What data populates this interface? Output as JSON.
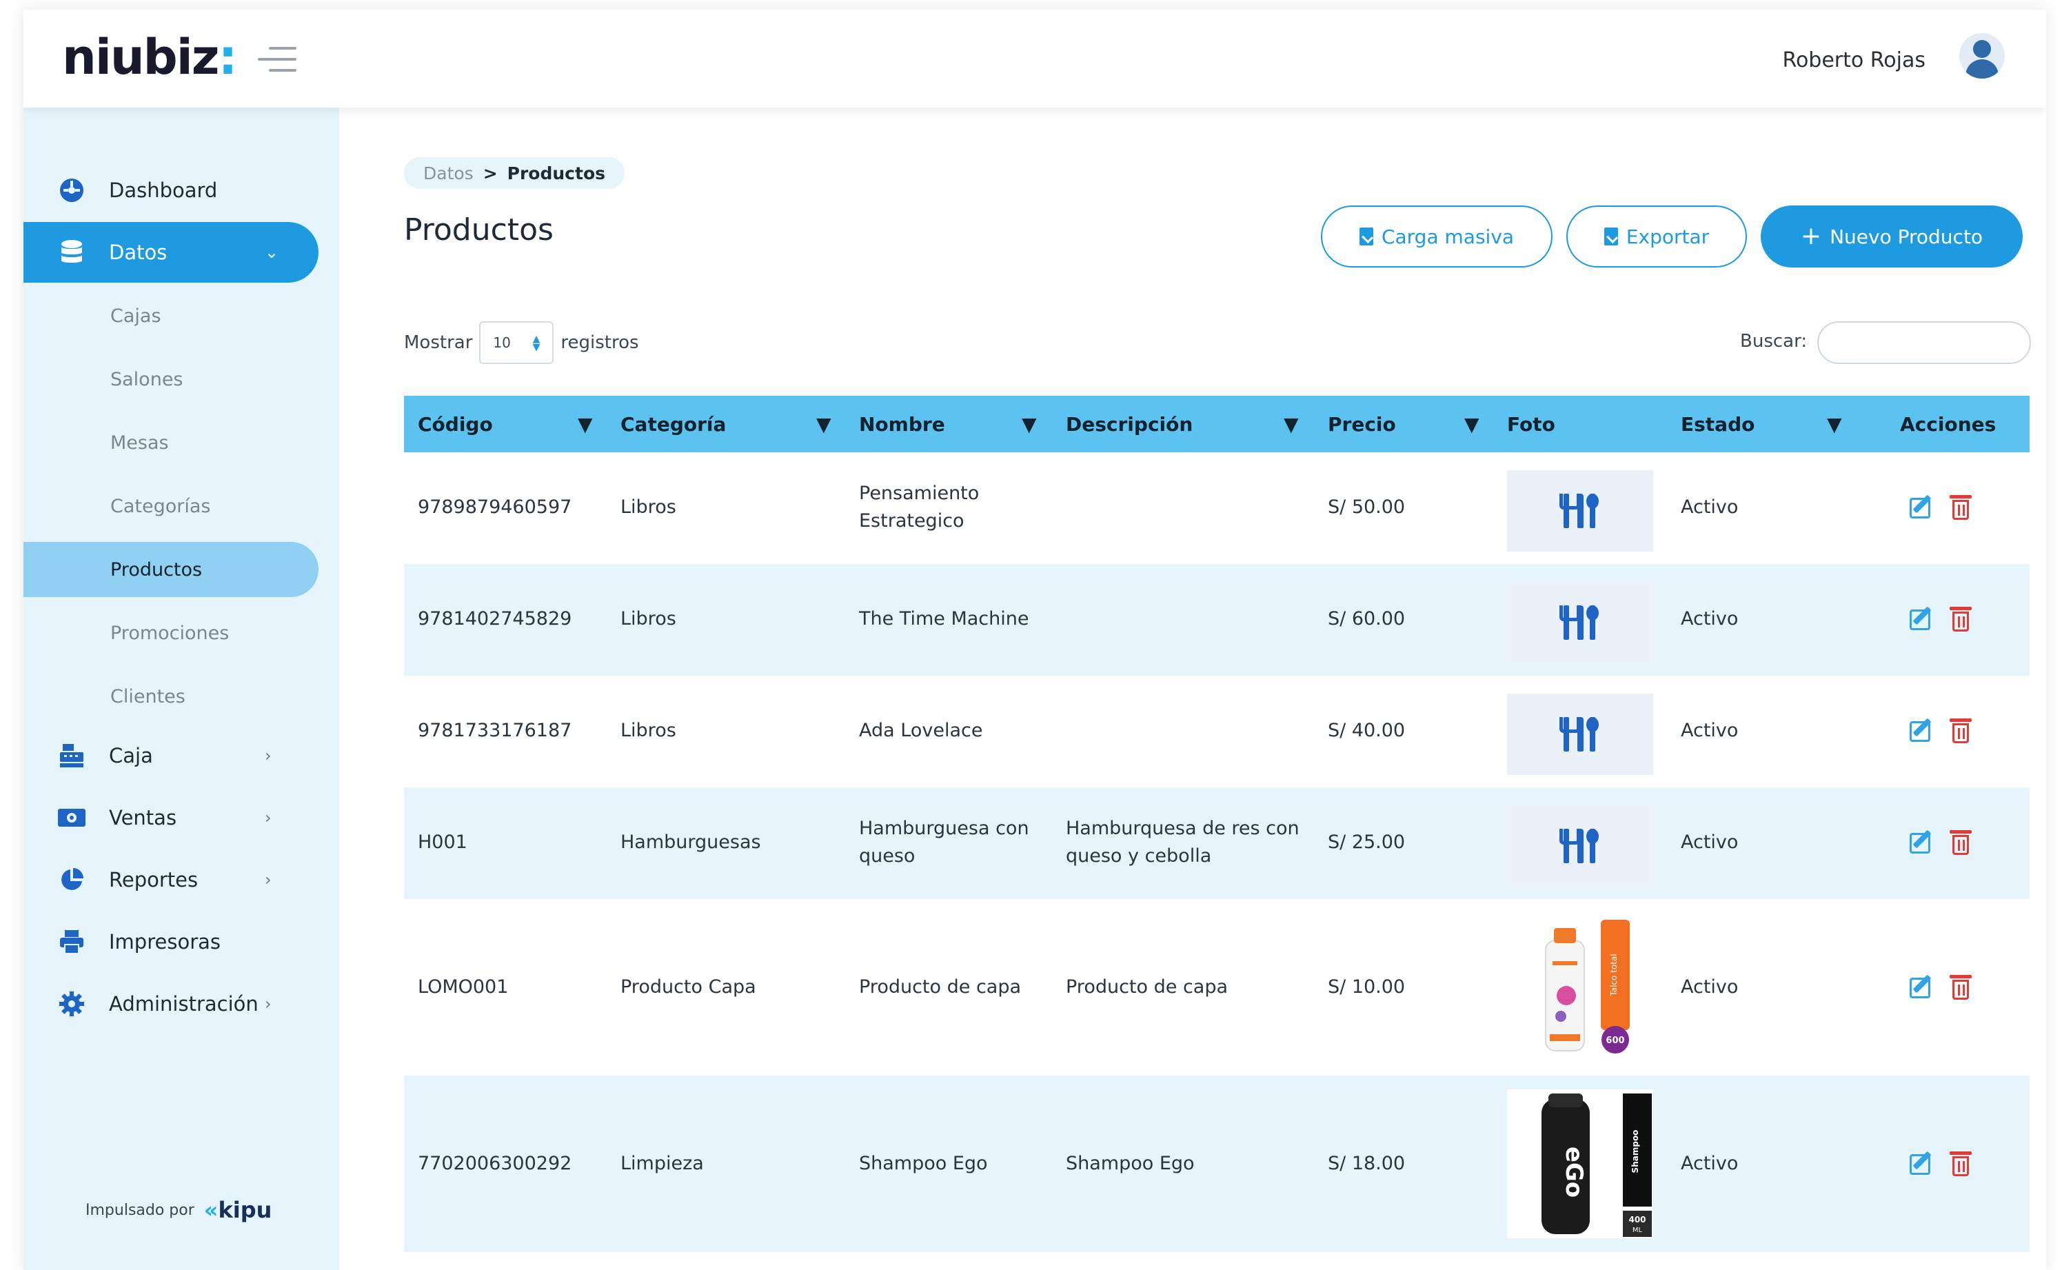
{
  "header": {
    "logo_text": "niubiz",
    "logo_colon": ":",
    "user_name": "Roberto Rojas"
  },
  "sidebar": {
    "items": [
      {
        "label": "Dashboard",
        "icon": "dashboard-icon"
      },
      {
        "label": "Datos",
        "icon": "database-icon",
        "chevron": "⌄"
      },
      {
        "label": "Caja",
        "icon": "cash-register-icon",
        "chevron": "›"
      },
      {
        "label": "Ventas",
        "icon": "money-icon",
        "chevron": "›"
      },
      {
        "label": "Reportes",
        "icon": "pie-chart-icon",
        "chevron": "›"
      },
      {
        "label": "Impresoras",
        "icon": "printer-icon"
      },
      {
        "label": "Administración",
        "icon": "gear-icon",
        "chevron": "›"
      }
    ],
    "sub_items": [
      {
        "label": "Cajas"
      },
      {
        "label": "Salones"
      },
      {
        "label": "Mesas"
      },
      {
        "label": "Categorías"
      },
      {
        "label": "Productos"
      },
      {
        "label": "Promociones"
      },
      {
        "label": "Clientes"
      }
    ],
    "powered_by": "Impulsado por",
    "powered_brand": "kipu"
  },
  "main": {
    "breadcrumb_parent": "Datos",
    "breadcrumb_sep": ">",
    "breadcrumb_current": "Productos",
    "title": "Productos",
    "buttons": {
      "bulk_upload": "Carga masiva",
      "export": "Exportar",
      "new_product": "Nuevo Producto",
      "new_product_icon": "+"
    },
    "length": {
      "prefix": "Mostrar",
      "value": "10",
      "suffix": "registros"
    },
    "search": {
      "label": "Buscar:",
      "value": ""
    },
    "columns": [
      "Código",
      "Categoría",
      "Nombre",
      "Descripción",
      "Precio",
      "Foto",
      "Estado",
      "Acciones"
    ],
    "sort_glyph": "▼",
    "rows": [
      {
        "codigo": "9789879460597",
        "categoria": "Libros",
        "nombre_1": "Pensamiento",
        "nombre_2": "Estrategico",
        "descripcion_1": "",
        "descripcion_2": "",
        "precio": "S/ 50.00",
        "foto": "utensils-icon",
        "estado": "Activo"
      },
      {
        "codigo": "9781402745829",
        "categoria": "Libros",
        "nombre_1": "The Time Machine",
        "nombre_2": "",
        "descripcion_1": "",
        "descripcion_2": "",
        "precio": "S/ 60.00",
        "foto": "utensils-icon",
        "estado": "Activo"
      },
      {
        "codigo": "9781733176187",
        "categoria": "Libros",
        "nombre_1": "Ada Lovelace",
        "nombre_2": "",
        "descripcion_1": "",
        "descripcion_2": "",
        "precio": "S/ 40.00",
        "foto": "utensils-icon",
        "estado": "Activo"
      },
      {
        "codigo": "H001",
        "categoria": "Hamburguesas",
        "nombre_1": "Hamburguesa con",
        "nombre_2": "queso",
        "descripcion_1": "Hamburquesa de res con",
        "descripcion_2": "queso y cebolla",
        "precio": "S/ 25.00",
        "foto": "utensils-icon",
        "estado": "Activo"
      },
      {
        "codigo": "LOMO001",
        "categoria": "Producto Capa",
        "nombre_1": "Producto de capa",
        "nombre_2": "",
        "descripcion_1": "Producto de capa",
        "descripcion_2": "",
        "precio": "S/ 10.00",
        "foto": "product-bottle-photo",
        "estado": "Activo"
      },
      {
        "codigo": "7702006300292",
        "categoria": "Limpieza",
        "nombre_1": "Shampoo Ego",
        "nombre_2": "",
        "descripcion_1": "Shampoo Ego",
        "descripcion_2": "",
        "precio": "S/ 18.00",
        "foto": "shampoo-bottle-photo",
        "estado": "Activo"
      }
    ],
    "product_badges": {
      "talc_side": "Talco total",
      "talc_size": "600",
      "shampoo_brand": "eGo",
      "shampoo_side": "Shampoo",
      "shampoo_size_1": "400",
      "shampoo_size_2": "ML"
    }
  },
  "colors": {
    "accent": "#1e9be0",
    "table_header": "#5cc3f1",
    "sidebar_bg": "#e6f5fc",
    "row_alt": "#e6f5fc",
    "icon_blue": "#1e63c6",
    "delete_red": "#e53935"
  }
}
